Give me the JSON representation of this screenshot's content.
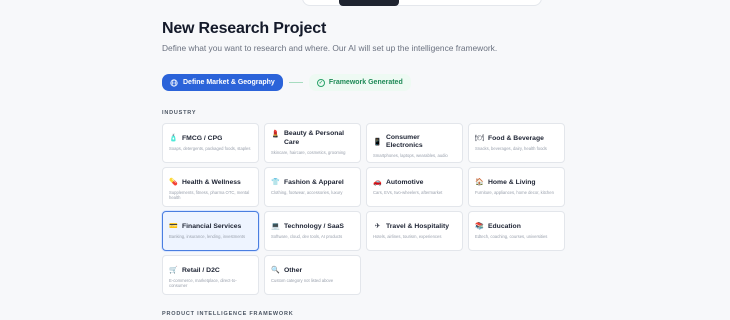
{
  "page": {
    "title": "New Research Project",
    "subtitle": "Define what you want to research and where. Our AI will set up the intelligence framework."
  },
  "stepper": {
    "step1": "Define Market & Geography",
    "step2": "Framework Generated"
  },
  "industry": {
    "label": "INDUSTRY",
    "cards": [
      {
        "name": "FMCG / CPG",
        "desc": "Soaps, detergents, packaged foods, staples",
        "icon": "soap-icon",
        "glyph": "🧴"
      },
      {
        "name": "Beauty & Personal Care",
        "desc": "Skincare, haircare, cosmetics, grooming",
        "icon": "lipstick-icon",
        "glyph": "💄"
      },
      {
        "name": "Consumer Electronics",
        "desc": "Smartphones, laptops, wearables, audio",
        "icon": "phone-icon",
        "glyph": "📱"
      },
      {
        "name": "Food & Beverage",
        "desc": "Snacks, beverages, dairy, health foods",
        "icon": "food-icon",
        "glyph": "🍽"
      },
      {
        "name": "Health & Wellness",
        "desc": "Supplements, fitness, pharma OTC, mental health",
        "icon": "pill-icon",
        "glyph": "💊"
      },
      {
        "name": "Fashion & Apparel",
        "desc": "Clothing, footwear, accessories, luxury",
        "icon": "shirt-icon",
        "glyph": "👕"
      },
      {
        "name": "Automotive",
        "desc": "Cars, EVs, two-wheelers, aftermarket",
        "icon": "car-icon",
        "glyph": "🚗"
      },
      {
        "name": "Home & Living",
        "desc": "Furniture, appliances, home decor, kitchen",
        "icon": "home-icon",
        "glyph": "🏠"
      },
      {
        "name": "Financial Services",
        "desc": "Banking, insurance, lending, investments",
        "icon": "card-icon",
        "glyph": "💳",
        "selected": true
      },
      {
        "name": "Technology / SaaS",
        "desc": "Software, cloud, dev tools, AI products",
        "icon": "laptop-icon",
        "glyph": "💻"
      },
      {
        "name": "Travel & Hospitality",
        "desc": "Hotels, airlines, tourism, experiences",
        "icon": "plane-icon",
        "glyph": "✈"
      },
      {
        "name": "Education",
        "desc": "Edtech, coaching, courses, universities",
        "icon": "books-icon",
        "glyph": "📚"
      },
      {
        "name": "Retail / D2C",
        "desc": "E-commerce, marketplace, direct-to-consumer",
        "icon": "cart-icon",
        "glyph": "🛒"
      },
      {
        "name": "Other",
        "desc": "Custom category not listed above",
        "icon": "magnifier-icon",
        "glyph": "🔍"
      }
    ]
  },
  "framework": {
    "label": "PRODUCT INTELLIGENCE FRAMEWORK"
  },
  "colors": {
    "accent": "#2b63d9",
    "success": "#1f8a57",
    "selected_border": "#4a7ee0"
  }
}
